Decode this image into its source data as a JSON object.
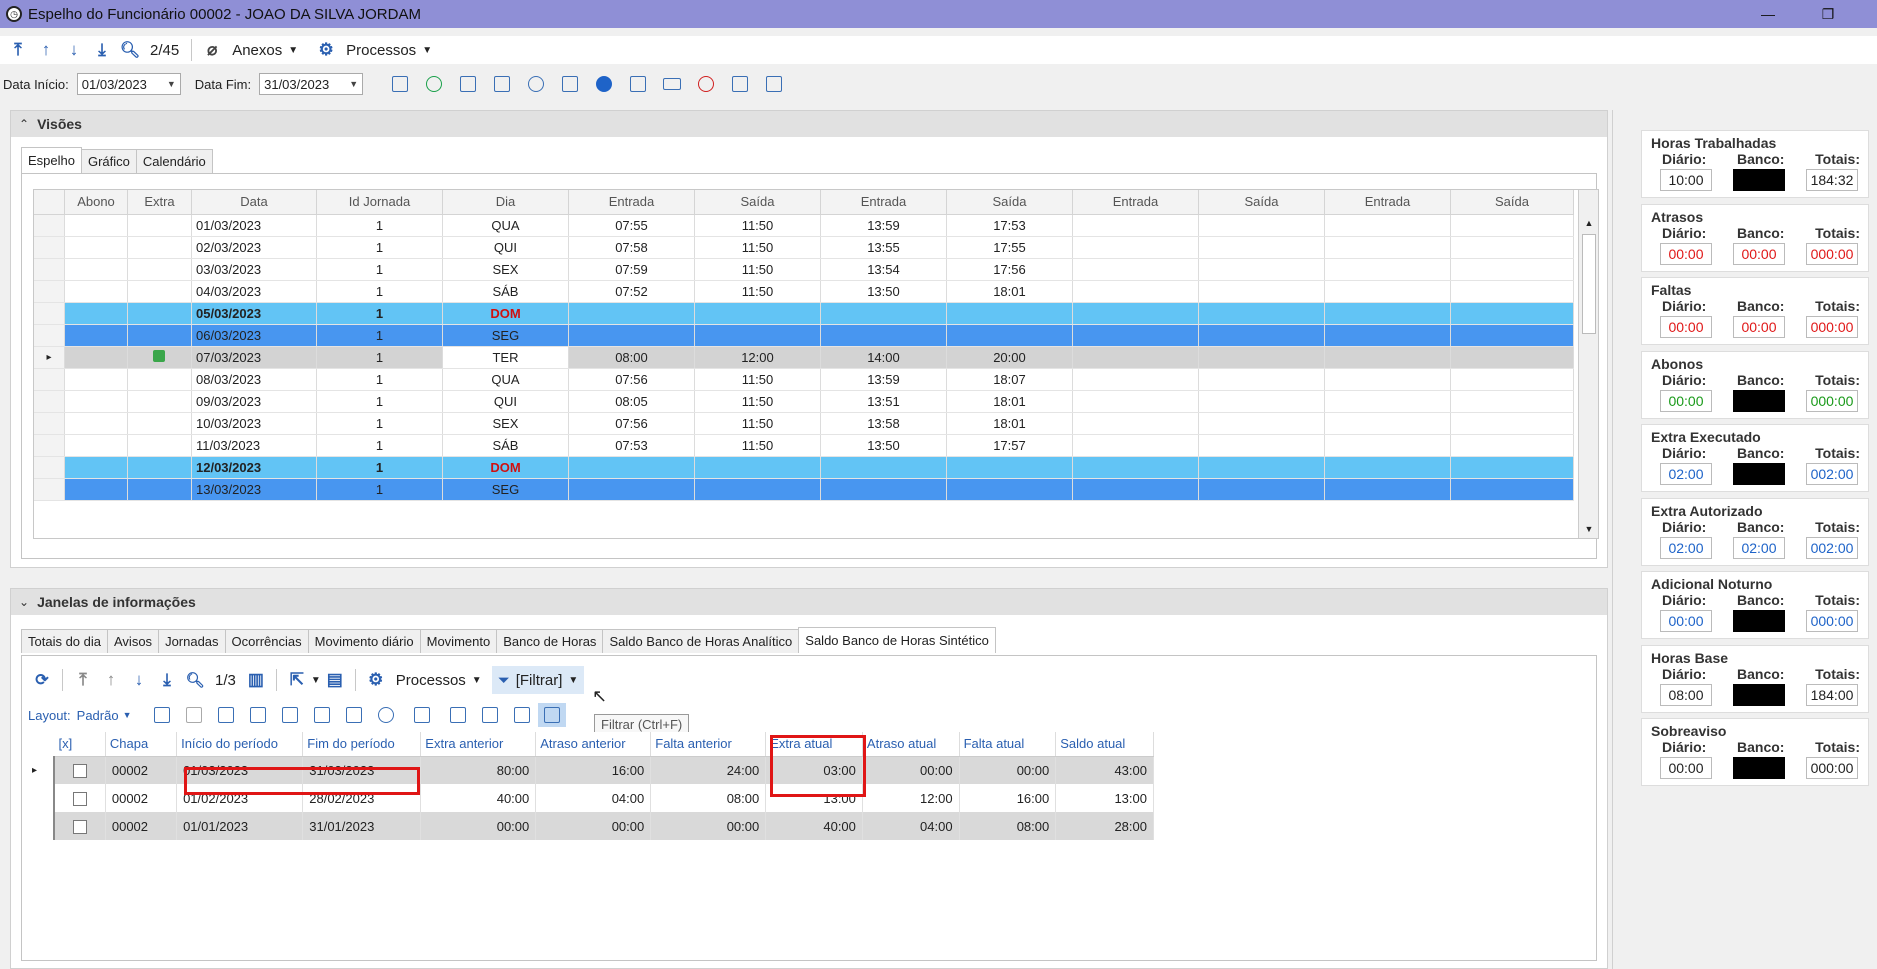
{
  "window": {
    "title": "Espelho do Funcionário 00002 - JOAO DA SILVA JORDAM",
    "min": "—",
    "restore": "❐"
  },
  "toolbar": {
    "record_counter": "2/45",
    "anexos": "Anexos",
    "processos": "Processos"
  },
  "filters": {
    "data_inicio_label": "Data Início:",
    "data_inicio": "01/03/2023",
    "data_fim_label": "Data Fim:",
    "data_fim": "31/03/2023"
  },
  "visoes": {
    "title": "Visões",
    "tabs": [
      "Espelho",
      "Gráfico",
      "Calendário"
    ],
    "columns": [
      "Abono",
      "Extra",
      "Data",
      "Id Jornada",
      "Dia",
      "Entrada",
      "Saída",
      "Entrada",
      "Saída",
      "Entrada",
      "Saída",
      "Entrada",
      "Saída"
    ],
    "rows": [
      {
        "data": "01/03/2023",
        "id": "1",
        "dia": "QUA",
        "e1": "07:55",
        "s1": "11:50",
        "e2": "13:59",
        "s2": "17:53",
        "style": "norm"
      },
      {
        "data": "02/03/2023",
        "id": "1",
        "dia": "QUI",
        "e1": "07:58",
        "s1": "11:50",
        "e2": "13:55",
        "s2": "17:55",
        "style": "norm"
      },
      {
        "data": "03/03/2023",
        "id": "1",
        "dia": "SEX",
        "e1": "07:59",
        "s1": "11:50",
        "e2": "13:54",
        "s2": "17:56",
        "style": "norm"
      },
      {
        "data": "04/03/2023",
        "id": "1",
        "dia": "SÁB",
        "e1": "07:52",
        "s1": "11:50",
        "e2": "13:50",
        "s2": "18:01",
        "style": "norm"
      },
      {
        "data": "05/03/2023",
        "id": "1",
        "dia": "DOM",
        "e1": "",
        "s1": "",
        "e2": "",
        "s2": "",
        "style": "sunday"
      },
      {
        "data": "06/03/2023",
        "id": "1",
        "dia": "SEG",
        "e1": "",
        "s1": "",
        "e2": "",
        "s2": "",
        "style": "blue"
      },
      {
        "data": "07/03/2023",
        "id": "1",
        "dia": "TER",
        "e1": "08:00",
        "s1": "12:00",
        "e2": "14:00",
        "s2": "20:00",
        "style": "sel"
      },
      {
        "data": "08/03/2023",
        "id": "1",
        "dia": "QUA",
        "e1": "07:56",
        "s1": "11:50",
        "e2": "13:59",
        "s2": "18:07",
        "style": "norm"
      },
      {
        "data": "09/03/2023",
        "id": "1",
        "dia": "QUI",
        "e1": "08:05",
        "s1": "11:50",
        "e2": "13:51",
        "s2": "18:01",
        "style": "norm"
      },
      {
        "data": "10/03/2023",
        "id": "1",
        "dia": "SEX",
        "e1": "07:56",
        "s1": "11:50",
        "e2": "13:58",
        "s2": "18:01",
        "style": "norm"
      },
      {
        "data": "11/03/2023",
        "id": "1",
        "dia": "SÁB",
        "e1": "07:53",
        "s1": "11:50",
        "e2": "13:50",
        "s2": "17:57",
        "style": "norm"
      },
      {
        "data": "12/03/2023",
        "id": "1",
        "dia": "DOM",
        "e1": "",
        "s1": "",
        "e2": "",
        "s2": "",
        "style": "sunday"
      },
      {
        "data": "13/03/2023",
        "id": "1",
        "dia": "SEG",
        "e1": "",
        "s1": "",
        "e2": "",
        "s2": "",
        "style": "blue"
      }
    ]
  },
  "janelas": {
    "title": "Janelas de informações",
    "tabs": [
      "Totais do dia",
      "Avisos",
      "Jornadas",
      "Ocorrências",
      "Movimento diário",
      "Movimento",
      "Banco de Horas",
      "Saldo Banco de Horas Analítico",
      "Saldo Banco de Horas Sintético"
    ],
    "counter": "1/3",
    "processos": "Processos",
    "filtrar": "[Filtrar]",
    "tooltip": "Filtrar (Ctrl+F)",
    "layout_label": "Layout:",
    "layout_value": "Padrão",
    "columns": [
      "[x]",
      "Chapa",
      "Início do período",
      "Fim do período",
      "Extra anterior",
      "Atraso anterior",
      "Falta anterior",
      "Extra atual",
      "Atraso atual",
      "Falta atual",
      "Saldo atual"
    ],
    "rows": [
      [
        "00002",
        "01/03/2023",
        "31/03/2023",
        "80:00",
        "16:00",
        "24:00",
        "03:00",
        "00:00",
        "00:00",
        "43:00"
      ],
      [
        "00002",
        "01/02/2023",
        "28/02/2023",
        "40:00",
        "04:00",
        "08:00",
        "13:00",
        "12:00",
        "16:00",
        "13:00"
      ],
      [
        "00002",
        "01/01/2023",
        "31/01/2023",
        "00:00",
        "00:00",
        "00:00",
        "40:00",
        "04:00",
        "08:00",
        "28:00"
      ]
    ]
  },
  "labels": {
    "diario": "Diário:",
    "banco": "Banco:",
    "totais": "Totais:"
  },
  "summary": [
    {
      "title": "Horas Trabalhadas",
      "diario": "10:00",
      "banco": "",
      "totais": "184:32",
      "color": "none"
    },
    {
      "title": "Atrasos",
      "diario": "00:00",
      "banco": "00:00",
      "totais": "000:00",
      "color": "red"
    },
    {
      "title": "Faltas",
      "diario": "00:00",
      "banco": "00:00",
      "totais": "000:00",
      "color": "red"
    },
    {
      "title": "Abonos",
      "diario": "00:00",
      "banco": "",
      "totais": "000:00",
      "color": "green"
    },
    {
      "title": "Extra Executado",
      "diario": "02:00",
      "banco": "",
      "totais": "002:00",
      "color": "blue"
    },
    {
      "title": "Extra Autorizado",
      "diario": "02:00",
      "banco": "02:00",
      "totais": "002:00",
      "color": "blue"
    },
    {
      "title": "Adicional Noturno",
      "diario": "00:00",
      "banco": "",
      "totais": "000:00",
      "color": "blue"
    },
    {
      "title": "Horas Base",
      "diario": "08:00",
      "banco": "",
      "totais": "184:00",
      "color": "none"
    },
    {
      "title": "Sobreaviso",
      "diario": "00:00",
      "banco": "",
      "totais": "000:00",
      "color": "none"
    }
  ]
}
